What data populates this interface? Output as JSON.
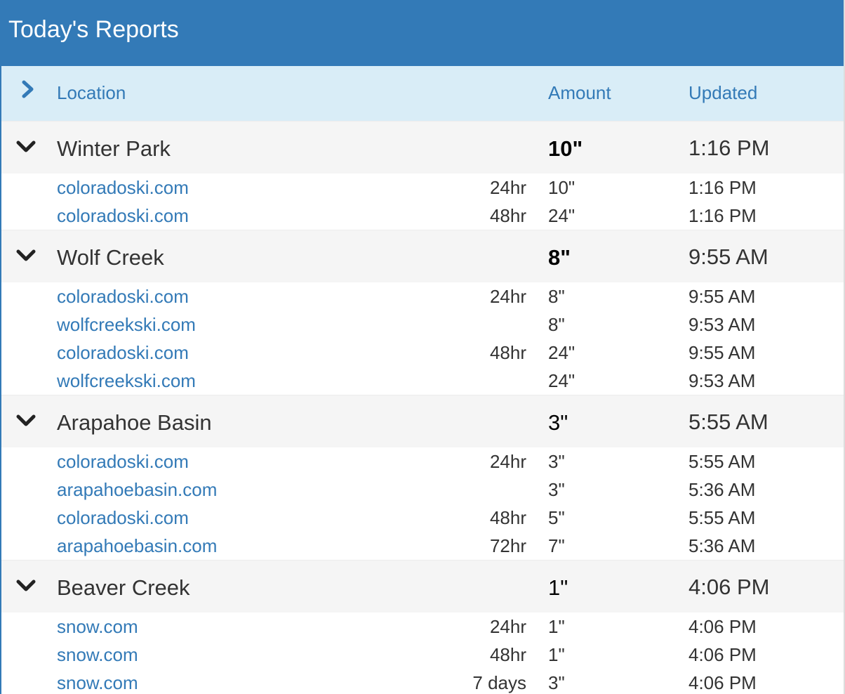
{
  "panel": {
    "title": "Today's Reports"
  },
  "table": {
    "headers": {
      "expand_icon": "chevron-right-icon",
      "location": "Location",
      "amount": "Amount",
      "updated": "Updated"
    },
    "groups": [
      {
        "name": "Winter Park",
        "amount": "10\"",
        "amount_bold": true,
        "updated": "1:16 PM",
        "reports": [
          {
            "source": "coloradoski.com",
            "period": "24hr",
            "amount": "10\"",
            "updated": "1:16 PM"
          },
          {
            "source": "coloradoski.com",
            "period": "48hr",
            "amount": "24\"",
            "updated": "1:16 PM"
          }
        ]
      },
      {
        "name": "Wolf Creek",
        "amount": "8\"",
        "amount_bold": true,
        "updated": "9:55 AM",
        "reports": [
          {
            "source": "coloradoski.com",
            "period": "24hr",
            "amount": "8\"",
            "updated": "9:55 AM"
          },
          {
            "source": "wolfcreekski.com",
            "period": "",
            "amount": "8\"",
            "updated": "9:53 AM"
          },
          {
            "source": "coloradoski.com",
            "period": "48hr",
            "amount": "24\"",
            "updated": "9:55 AM"
          },
          {
            "source": "wolfcreekski.com",
            "period": "",
            "amount": "24\"",
            "updated": "9:53 AM"
          }
        ]
      },
      {
        "name": "Arapahoe Basin",
        "amount": "3\"",
        "amount_bold": false,
        "updated": "5:55 AM",
        "reports": [
          {
            "source": "coloradoski.com",
            "period": "24hr",
            "amount": "3\"",
            "updated": "5:55 AM"
          },
          {
            "source": "arapahoebasin.com",
            "period": "",
            "amount": "3\"",
            "updated": "5:36 AM"
          },
          {
            "source": "coloradoski.com",
            "period": "48hr",
            "amount": "5\"",
            "updated": "5:55 AM"
          },
          {
            "source": "arapahoebasin.com",
            "period": "72hr",
            "amount": "7\"",
            "updated": "5:36 AM"
          }
        ]
      },
      {
        "name": "Beaver Creek",
        "amount": "1\"",
        "amount_bold": false,
        "updated": "4:06 PM",
        "reports": [
          {
            "source": "snow.com",
            "period": "24hr",
            "amount": "1\"",
            "updated": "4:06 PM"
          },
          {
            "source": "snow.com",
            "period": "48hr",
            "amount": "1\"",
            "updated": "4:06 PM"
          },
          {
            "source": "snow.com",
            "period": "7 days",
            "amount": "3\"",
            "updated": "4:06 PM"
          }
        ]
      }
    ]
  },
  "colors": {
    "primary": "#337ab7",
    "header_bg": "#d9edf7",
    "group_bg": "#f5f5f5",
    "text": "#333333"
  }
}
